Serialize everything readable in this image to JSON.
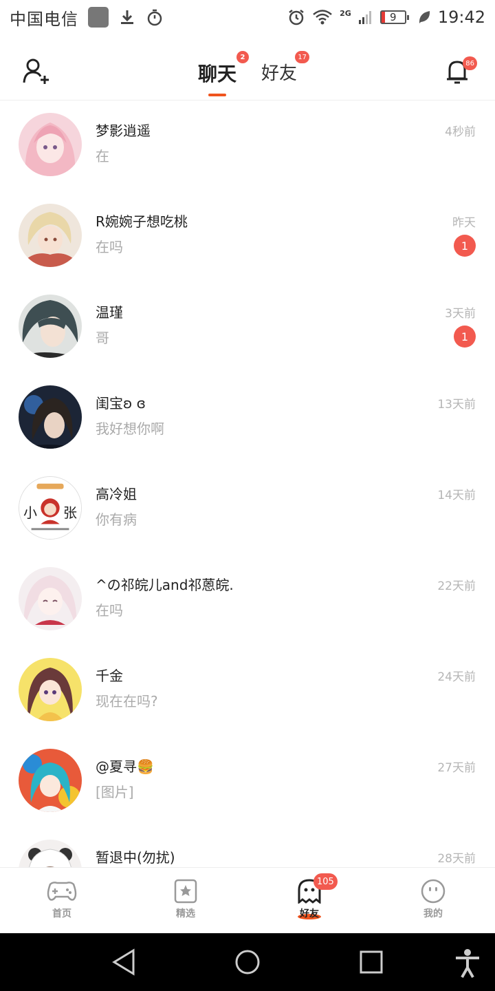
{
  "status_bar": {
    "carrier": "中国电信",
    "network": "2G",
    "battery_level": "9",
    "time": "19:42"
  },
  "header": {
    "add_friend_icon": "add-person-icon",
    "tabs": [
      {
        "label": "聊天",
        "badge": "2",
        "active": true
      },
      {
        "label": "好友",
        "badge": "17",
        "active": false
      }
    ],
    "notification_badge": "86",
    "accent_color": "#f0541e",
    "badge_color": "#f25a4f"
  },
  "chats": [
    {
      "name": "梦影逍遥",
      "preview": "在",
      "time": "4秒前",
      "unread": ""
    },
    {
      "name": "R婉婉子想吃桃",
      "preview": "在吗",
      "time": "昨天",
      "unread": "1"
    },
    {
      "name": "温瑾",
      "preview": "哥",
      "time": "3天前",
      "unread": "1"
    },
    {
      "name": "闺宝ʚ ɞ",
      "preview": "我好想你啊",
      "time": "13天前",
      "unread": ""
    },
    {
      "name": "高冷姐",
      "preview": "你有病",
      "time": "14天前",
      "unread": "",
      "avatar_text_left": "小",
      "avatar_text_right": "张"
    },
    {
      "name": "^の祁皖儿and祁蒽皖.",
      "preview": "在吗",
      "time": "22天前",
      "unread": ""
    },
    {
      "name": "千金",
      "preview": "现在在吗?",
      "time": "24天前",
      "unread": ""
    },
    {
      "name": "@夏寻🍔",
      "preview": "[图片]",
      "time": "27天前",
      "unread": ""
    },
    {
      "name": "暂退中(勿扰)",
      "preview": "",
      "time": "28天前",
      "unread": ""
    }
  ],
  "bottom_nav": [
    {
      "label": "首页",
      "icon": "gamepad-icon",
      "active": false
    },
    {
      "label": "精选",
      "icon": "star-card-icon",
      "active": false
    },
    {
      "label": "好友",
      "icon": "ghost-icon",
      "active": true,
      "badge": "105"
    },
    {
      "label": "我的",
      "icon": "face-icon",
      "active": false
    }
  ]
}
